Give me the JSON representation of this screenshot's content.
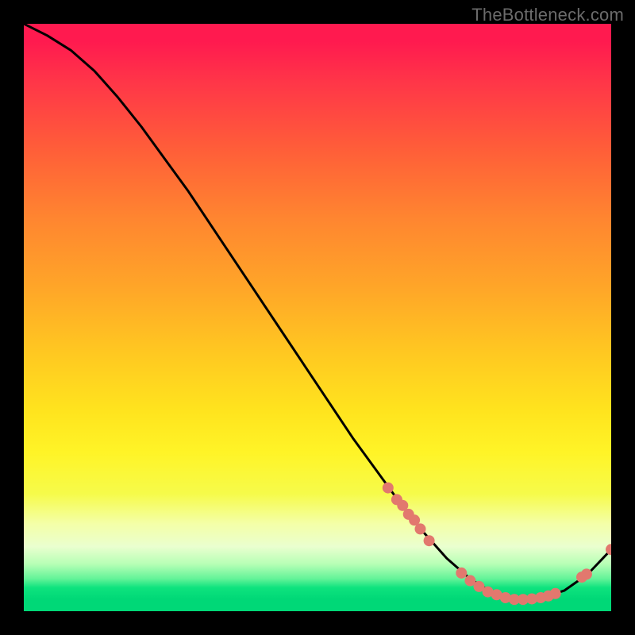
{
  "watermark": "TheBottleneck.com",
  "chart_data": {
    "type": "line",
    "title": "",
    "xlabel": "",
    "ylabel": "",
    "xlim": [
      0,
      100
    ],
    "ylim": [
      0,
      100
    ],
    "series": [
      {
        "name": "curve",
        "x": [
          0,
          4,
          8,
          12,
          16,
          20,
          24,
          28,
          32,
          36,
          40,
          44,
          48,
          52,
          56,
          60,
          64,
          68,
          72,
          76,
          80,
          84,
          88,
          92,
          96,
          100
        ],
        "y": [
          100,
          98,
          95.5,
          92,
          87.5,
          82.5,
          77,
          71.5,
          65.5,
          59.5,
          53.5,
          47.5,
          41.5,
          35.5,
          29.5,
          24,
          18.5,
          13.5,
          9,
          5.5,
          3,
          2,
          2.2,
          3.5,
          6.3,
          10.5
        ]
      }
    ],
    "dots": [
      {
        "x": 62.0,
        "y": 21.0
      },
      {
        "x": 63.5,
        "y": 19.0
      },
      {
        "x": 64.5,
        "y": 18.0
      },
      {
        "x": 65.5,
        "y": 16.5
      },
      {
        "x": 66.5,
        "y": 15.5
      },
      {
        "x": 67.5,
        "y": 14.0
      },
      {
        "x": 69.0,
        "y": 12.0
      },
      {
        "x": 74.5,
        "y": 6.5
      },
      {
        "x": 76.0,
        "y": 5.2
      },
      {
        "x": 77.5,
        "y": 4.2
      },
      {
        "x": 79.0,
        "y": 3.3
      },
      {
        "x": 80.5,
        "y": 2.8
      },
      {
        "x": 82.0,
        "y": 2.3
      },
      {
        "x": 83.5,
        "y": 2.0
      },
      {
        "x": 85.0,
        "y": 2.0
      },
      {
        "x": 86.5,
        "y": 2.1
      },
      {
        "x": 88.0,
        "y": 2.3
      },
      {
        "x": 89.3,
        "y": 2.6
      },
      {
        "x": 90.5,
        "y": 3.0
      },
      {
        "x": 95.0,
        "y": 5.8
      },
      {
        "x": 95.8,
        "y": 6.3
      },
      {
        "x": 100.0,
        "y": 10.5
      }
    ],
    "dot_color": "#e2786e",
    "dot_radius": 7,
    "curve_color": "#000000",
    "curve_width": 3
  }
}
